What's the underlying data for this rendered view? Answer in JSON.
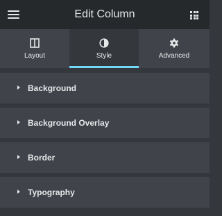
{
  "header": {
    "title": "Edit Column",
    "menu_icon": "hamburger-icon",
    "apps_icon": "grid-icon"
  },
  "tabs": [
    {
      "label": "Layout",
      "icon": "columns-icon",
      "active": false
    },
    {
      "label": "Style",
      "icon": "contrast-icon",
      "active": true
    },
    {
      "label": "Advanced",
      "icon": "gear-icon",
      "active": false
    }
  ],
  "sections": [
    {
      "label": "Background",
      "icon": "caret-right-icon"
    },
    {
      "label": "Background Overlay",
      "icon": "caret-right-icon"
    },
    {
      "label": "Border",
      "icon": "caret-right-icon"
    },
    {
      "label": "Typography",
      "icon": "caret-right-icon"
    }
  ],
  "colors": {
    "header_bg": "#26292c",
    "panel_bg": "#34383c",
    "section_bg": "#404349",
    "text": "#e6e8ea",
    "accent": "#71d7f7"
  }
}
